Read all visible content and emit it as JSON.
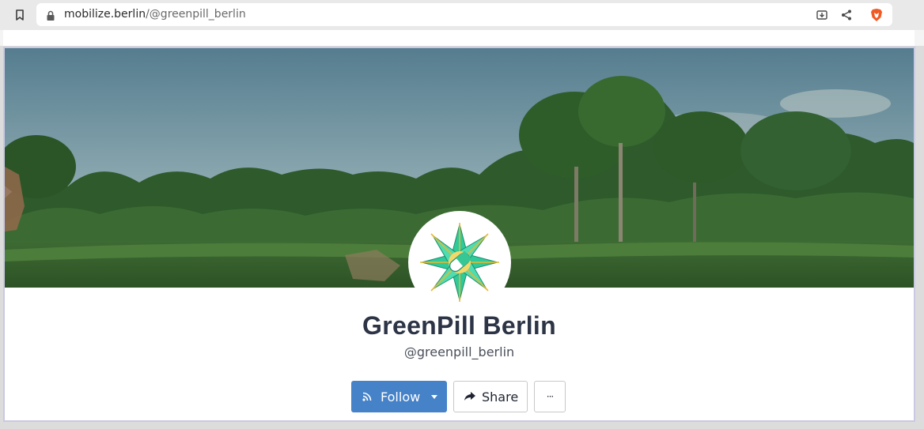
{
  "browser": {
    "url_domain": "mobilize.berlin",
    "url_path": "/@greenpill_berlin",
    "bookmark_icon": "bookmark-icon",
    "lock_icon": "lock-icon",
    "install_icon": "install-app-icon",
    "share_icon": "share-icon",
    "brave_icon": "brave-shields-icon"
  },
  "profile": {
    "name": "GreenPill Berlin",
    "handle": "@greenpill_berlin",
    "avatar_icon": "greenpill-star-logo",
    "banner": "forest-landscape-banner"
  },
  "actions": {
    "follow_label": "Follow",
    "share_label": "Share",
    "more_label": "···"
  },
  "colors": {
    "primary": "#4682c8",
    "title": "#2c3446",
    "card_border": "#c9c9e2"
  }
}
